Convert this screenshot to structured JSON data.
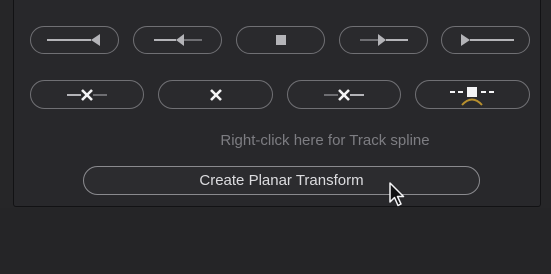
{
  "panel": {
    "transport_row": [
      {
        "name": "track-reverse-button",
        "icon": "track-reverse-icon"
      },
      {
        "name": "step-reverse-button",
        "icon": "step-reverse-icon"
      },
      {
        "name": "stop-button",
        "icon": "stop-icon"
      },
      {
        "name": "step-forward-button",
        "icon": "step-forward-icon"
      },
      {
        "name": "track-forward-button",
        "icon": "track-forward-icon"
      }
    ],
    "keyframe_row": [
      {
        "name": "clear-keyframes-before-button",
        "icon": "clear-before-icon"
      },
      {
        "name": "clear-keyframe-button",
        "icon": "clear-icon"
      },
      {
        "name": "clear-keyframes-after-button",
        "icon": "clear-after-icon"
      },
      {
        "name": "keyframe-spline-button",
        "icon": "keyframe-spline-icon"
      }
    ],
    "track_hint": "Right-click here for Track spline",
    "create_button_label": "Create Planar Transform"
  },
  "colors": {
    "panel_background": "#28282b",
    "pill_border": "#707074",
    "icon": "#b4b4b8",
    "icon_bright": "#f4f4f6",
    "hint_text": "#7d7d82",
    "button_text": "#dcdcdf"
  }
}
